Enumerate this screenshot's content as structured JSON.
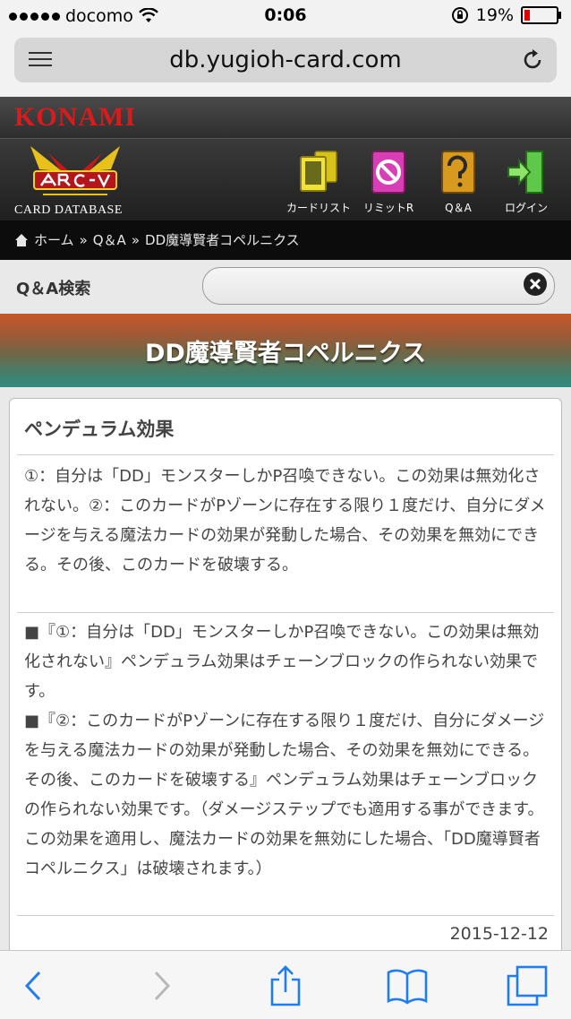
{
  "status": {
    "carrier": "docomo",
    "time": "0:06",
    "battery": "19%"
  },
  "browser": {
    "url": "db.yugioh-card.com"
  },
  "site": {
    "konami": "KONAMI",
    "db_label": "CARD DATABASE",
    "nav": [
      {
        "label": "カードリスト"
      },
      {
        "label": "リミットR"
      },
      {
        "label": "Q＆A"
      },
      {
        "label": "ログイン"
      }
    ]
  },
  "breadcrumb": {
    "home": "ホーム",
    "sep": "»",
    "qa": "Q＆A",
    "current": "DD魔導賢者コペルニクス"
  },
  "search": {
    "label": "Q＆A検索",
    "value": "",
    "placeholder": ""
  },
  "page": {
    "title": "DD魔導賢者コペルニクス"
  },
  "card": {
    "heading": "ペンデュラム効果",
    "effect": "①：自分は「DD」モンスターしかP召喚できない。この効果は無効化されない。②：このカードがPゾーンに存在する限り１度だけ、自分にダメージを与える魔法カードの効果が発動した場合、その効果を無効にできる。その後、このカードを破壊する。",
    "answer1": "■『①：自分は「DD」モンスターしかP召喚できない。この効果は無効化されない』ペンデュラム効果はチェーンブロックの作られない効果です。",
    "answer2": "■『②：このカードがPゾーンに存在する限り１度だけ、自分にダメージを与える魔法カードの効果が発動した場合、その効果を無効にできる。その後、このカードを破壊する』ペンデュラム効果はチェーンブロックの作られない効果です。（ダメージステップでも適用する事ができます。この効果を適用し、魔法カードの効果を無効にした場合、「DD魔導賢者コペルニクス」は破壊されます。）",
    "date": "2015-12-12"
  }
}
